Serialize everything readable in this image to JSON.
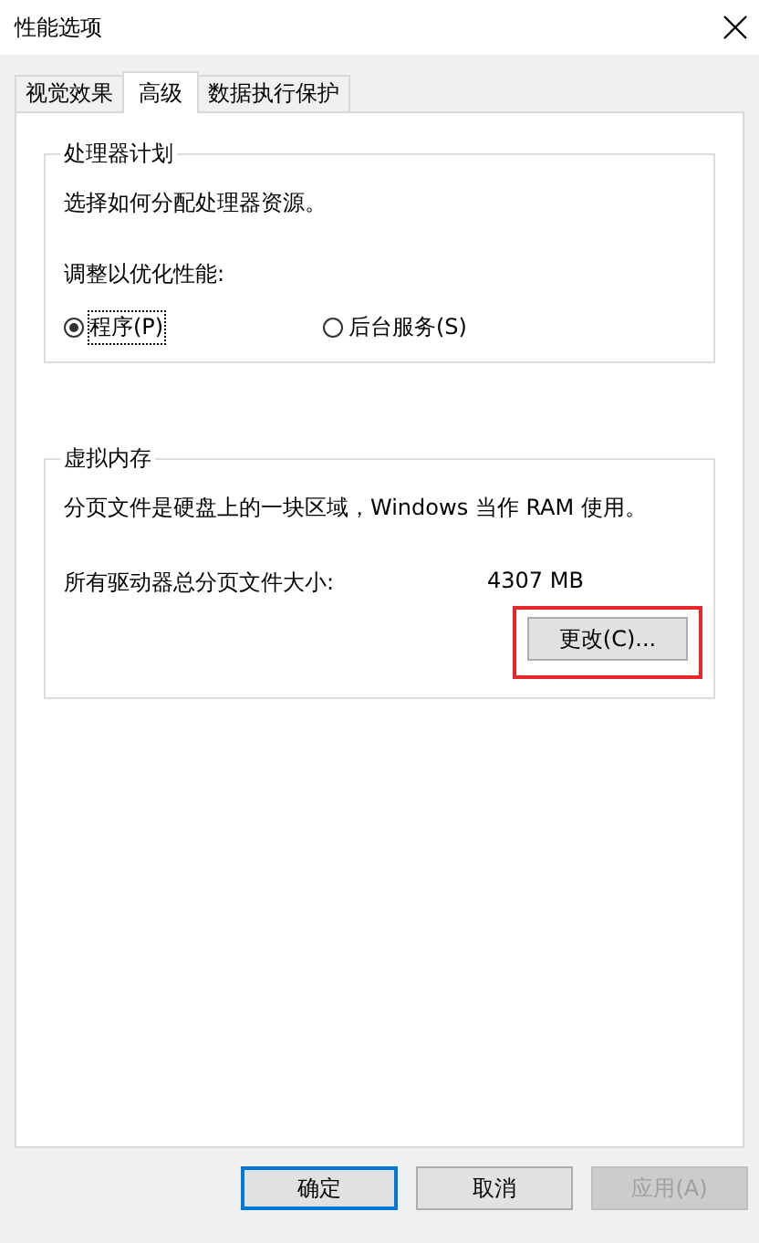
{
  "window": {
    "title": "性能选项"
  },
  "tabs": [
    {
      "label": "视觉效果",
      "selected": false
    },
    {
      "label": "高级",
      "selected": true
    },
    {
      "label": "数据执行保护",
      "selected": false
    }
  ],
  "processor_scheduling": {
    "title": "处理器计划",
    "description": "选择如何分配处理器资源。",
    "prompt": "调整以优化性能:",
    "options": [
      {
        "label": "程序(P)",
        "selected": true
      },
      {
        "label": "后台服务(S)",
        "selected": false
      }
    ]
  },
  "virtual_memory": {
    "title": "虚拟内存",
    "description": "分页文件是硬盘上的一块区域，Windows 当作 RAM 使用。",
    "size_label": "所有驱动器总分页文件大小:",
    "size_value": "4307 MB",
    "change_button": {
      "label": "更改(C)...",
      "highlighted": true
    }
  },
  "buttons": [
    {
      "label": "确定",
      "default": true,
      "disabled": false
    },
    {
      "label": "取消",
      "default": false,
      "disabled": false
    },
    {
      "label": "应用(A)",
      "default": false,
      "disabled": true
    }
  ]
}
